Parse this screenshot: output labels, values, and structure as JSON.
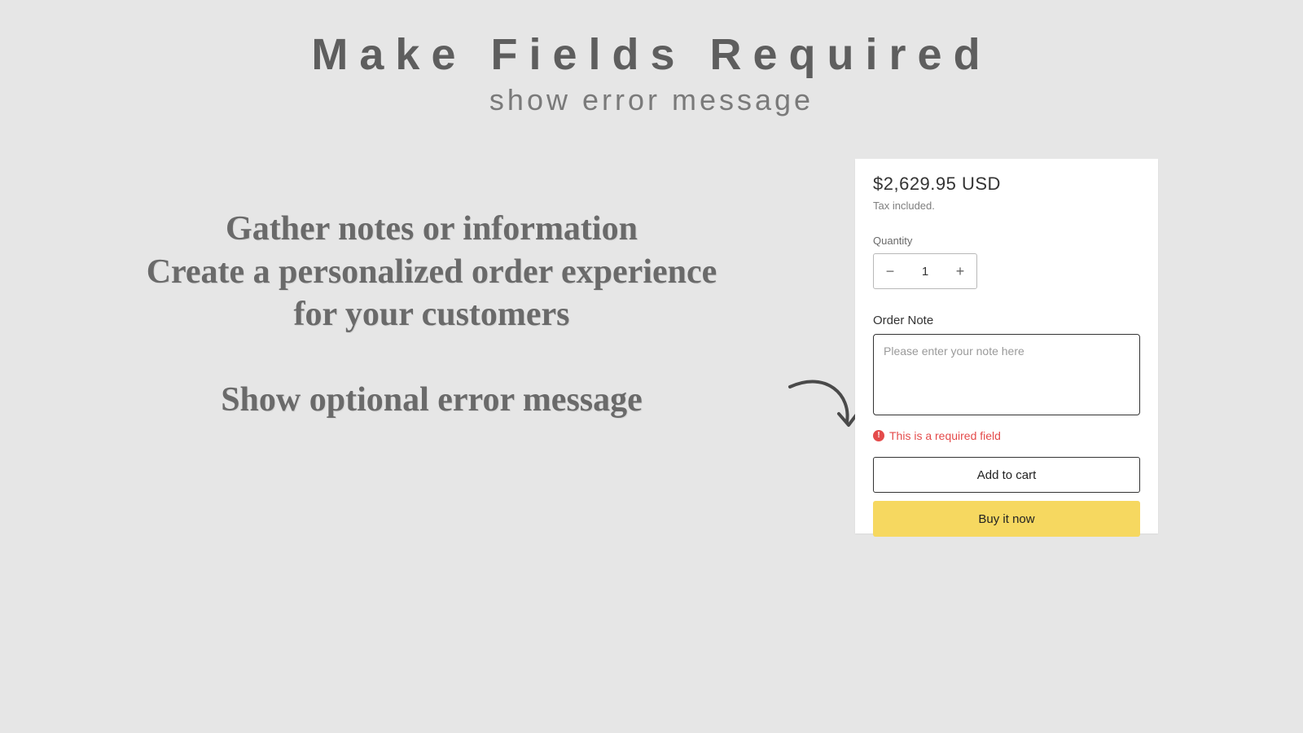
{
  "headline": {
    "title": "Make Fields Required",
    "subtitle": "show error message"
  },
  "marketing": {
    "line1": "Gather notes or information",
    "line2": "Create a personalized order experience",
    "line3": "for your customers",
    "line4": "Show optional error message"
  },
  "product": {
    "price": "$2,629.95 USD",
    "tax_note": "Tax included.",
    "quantity_label": "Quantity",
    "quantity_value": "1",
    "minus_glyph": "−",
    "plus_glyph": "+",
    "order_note_label": "Order Note",
    "order_note_placeholder": "Please enter your note here",
    "error_glyph": "!",
    "error_text": "This is a required field",
    "add_to_cart": "Add to cart",
    "buy_now": "Buy it now"
  }
}
